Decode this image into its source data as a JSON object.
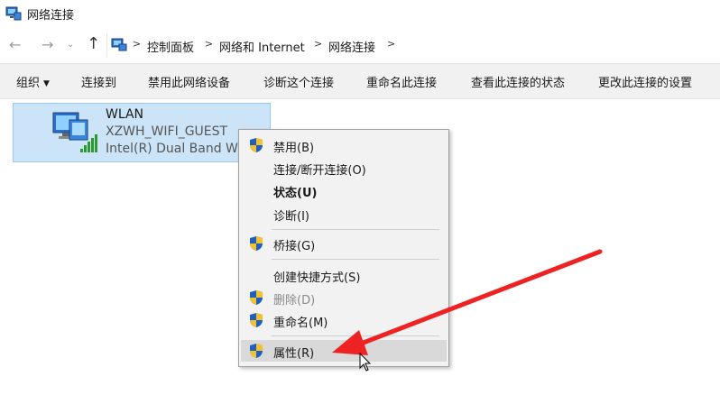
{
  "window": {
    "title": "网络连接"
  },
  "address": {
    "crumbs": [
      "控制面板",
      "网络和 Internet",
      "网络连接"
    ]
  },
  "toolbar": {
    "items": [
      {
        "label": "组织",
        "dropdown": true
      },
      {
        "label": "连接到"
      },
      {
        "label": "禁用此网络设备"
      },
      {
        "label": "诊断这个连接"
      },
      {
        "label": "重命名此连接"
      },
      {
        "label": "查看此连接的状态"
      },
      {
        "label": "更改此连接的设置"
      }
    ]
  },
  "connection": {
    "name": "WLAN",
    "ssid": "XZWH_WIFI_GUEST",
    "adapter": "Intel(R) Dual Band Wire"
  },
  "context_menu": {
    "items": [
      {
        "label": "禁用(B)",
        "shield": true
      },
      {
        "label": "连接/断开连接(O)",
        "shield": false
      },
      {
        "label": "状态(U)",
        "shield": false,
        "bold": true
      },
      {
        "label": "诊断(I)",
        "shield": false
      },
      {
        "label": "桥接(G)",
        "shield": true
      },
      {
        "label": "创建快捷方式(S)",
        "shield": false
      },
      {
        "label": "删除(D)",
        "shield": true,
        "disabled": true
      },
      {
        "label": "重命名(M)",
        "shield": true
      },
      {
        "label": "属性(R)",
        "shield": true,
        "hovered": true
      }
    ]
  },
  "colors": {
    "selection_bg": "#cce4f7",
    "annotation_arrow": "#ee2222",
    "shield_blue": "#1f5fbf",
    "shield_gold": "#f2c230"
  }
}
